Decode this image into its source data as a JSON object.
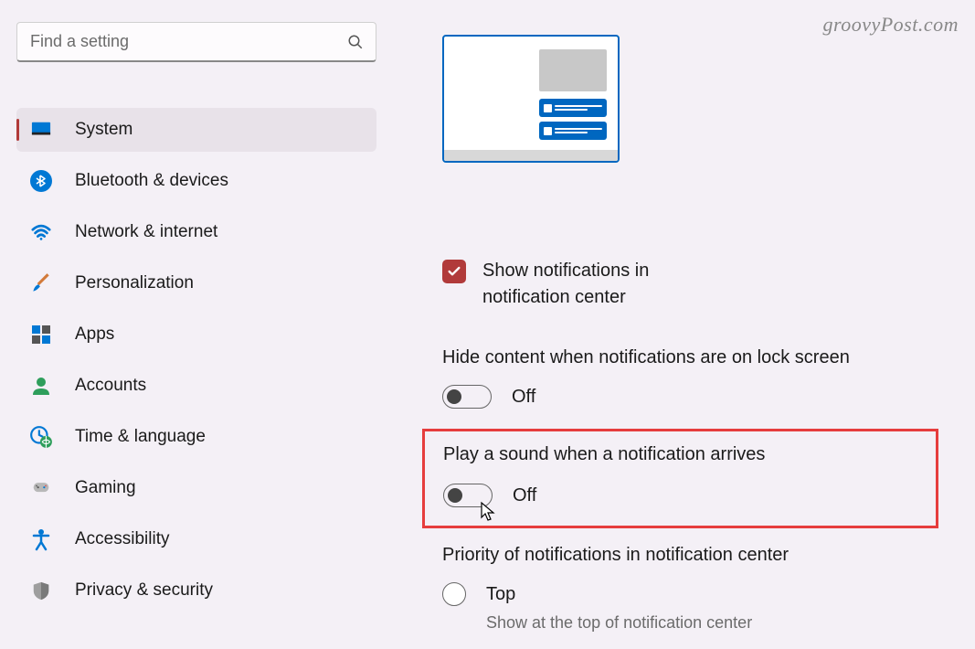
{
  "watermark": "groovyPost.com",
  "search": {
    "placeholder": "Find a setting"
  },
  "sidebar": {
    "items": [
      {
        "id": "system",
        "label": "System",
        "active": true
      },
      {
        "id": "bluetooth",
        "label": "Bluetooth & devices"
      },
      {
        "id": "network",
        "label": "Network & internet"
      },
      {
        "id": "personalization",
        "label": "Personalization"
      },
      {
        "id": "apps",
        "label": "Apps"
      },
      {
        "id": "accounts",
        "label": "Accounts"
      },
      {
        "id": "time",
        "label": "Time & language"
      },
      {
        "id": "gaming",
        "label": "Gaming"
      },
      {
        "id": "accessibility",
        "label": "Accessibility"
      },
      {
        "id": "privacy",
        "label": "Privacy & security"
      }
    ]
  },
  "main": {
    "show_notifications_checkbox": {
      "checked": true,
      "label_line1": "Show notifications in",
      "label_line2": "notification center"
    },
    "hide_content": {
      "title": "Hide content when notifications are on lock screen",
      "state": "Off",
      "on": false
    },
    "play_sound": {
      "title": "Play a sound when a notification arrives",
      "state": "Off",
      "on": false,
      "highlighted": true
    },
    "priority": {
      "title": "Priority of notifications in notification center",
      "option_label": "Top",
      "option_sub": "Show at the top of notification center"
    }
  }
}
